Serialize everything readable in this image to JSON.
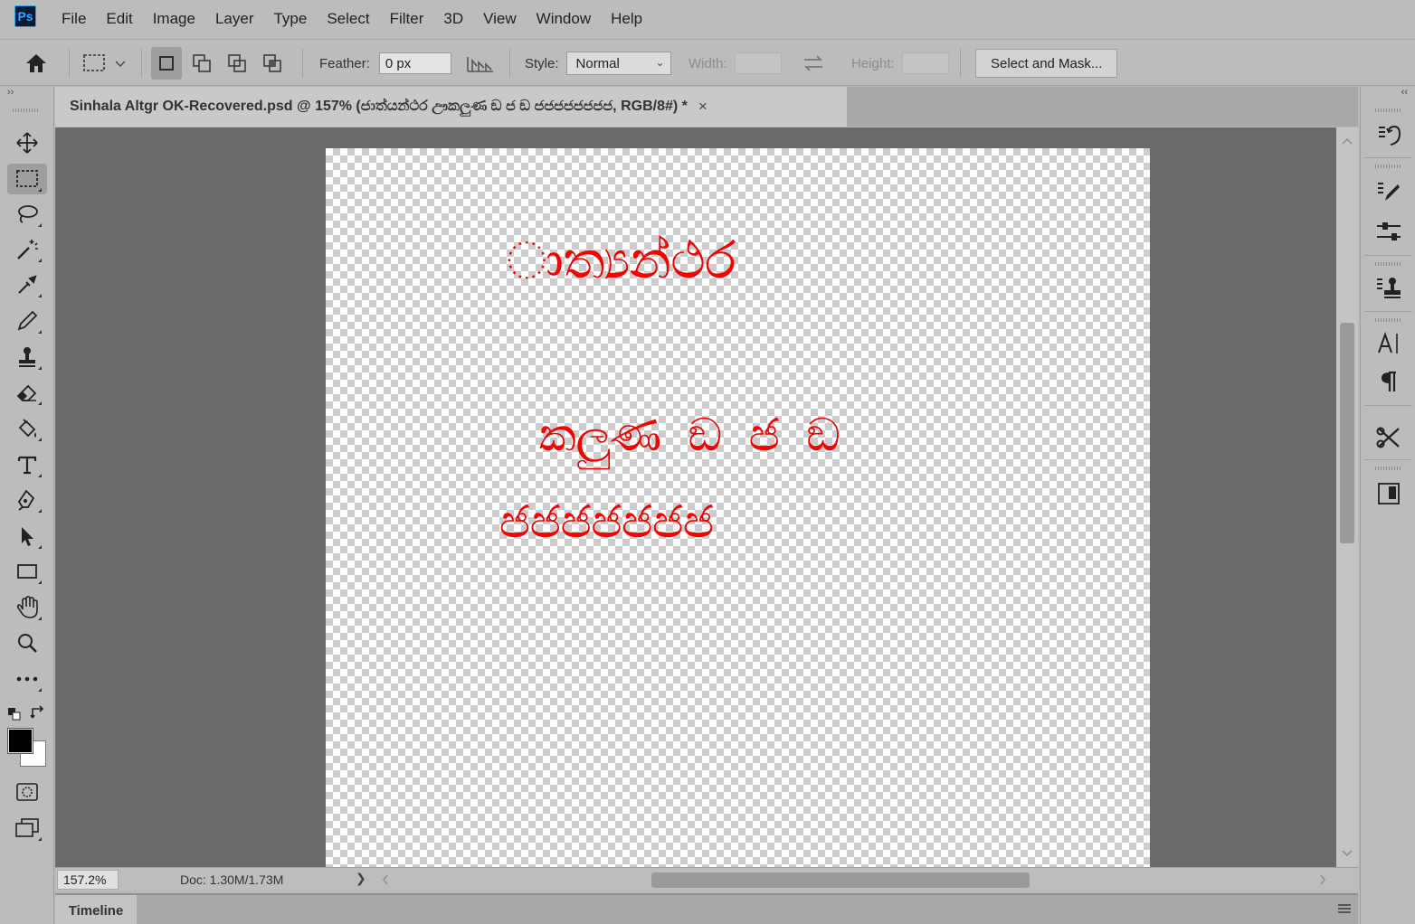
{
  "app": {
    "logo": "Ps"
  },
  "menu": [
    "File",
    "Edit",
    "Image",
    "Layer",
    "Type",
    "Select",
    "Filter",
    "3D",
    "View",
    "Window",
    "Help"
  ],
  "options": {
    "feather_label": "Feather:",
    "feather_value": "0 px",
    "style_label": "Style:",
    "style_value": "Normal",
    "width_label": "Width:",
    "height_label": "Height:",
    "select_mask_label": "Select and Mask..."
  },
  "document": {
    "tab_title": "Sinhala Altgr OK-Recovered.psd @ 157% (ජාත්යන්ථර ඌකලුණ ඞ ජ ඞ ජජජජජජජජ, RGB/8#) *",
    "close_glyph": "×",
    "canvas_lines": [
      "ාත්‍යන්ථර",
      "කලුණ  ඞ ජ ඞ",
      "ජජජජජජජ"
    ],
    "text_color": "#ff0000"
  },
  "status": {
    "zoom": "157.2%",
    "doc_info": "Doc: 1.30M/1.73M",
    "arrow": "❯"
  },
  "timeline": {
    "tab_label": "Timeline"
  },
  "toolbar_tools": [
    "move-tool",
    "rectangular-marquee-tool",
    "lasso-tool",
    "magic-wand-tool",
    "eyedropper-tool",
    "brush-tool",
    "clone-stamp-tool",
    "eraser-tool",
    "paint-bucket-tool",
    "type-tool",
    "pen-tool",
    "path-selection-tool",
    "rectangle-tool",
    "hand-tool",
    "zoom-tool",
    "edit-toolbar"
  ],
  "right_panels": [
    "history",
    "brush-settings",
    "adjustments",
    "clone-source",
    "character",
    "paragraph",
    "tool-presets",
    "libraries"
  ],
  "colors": {
    "foreground": "#000000",
    "background": "#ffffff",
    "accent": "#31a8ff"
  }
}
